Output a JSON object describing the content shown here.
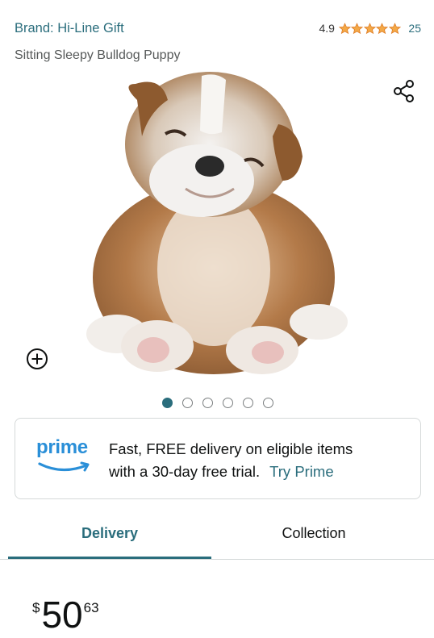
{
  "product": {
    "brand_label": "Brand: Hi-Line Gift",
    "rating_value": "4.9",
    "rating_stars": 4.9,
    "rating_count": "25",
    "title": "Sitting Sleepy Bulldog Puppy",
    "image_name": "bulldog-puppy-figurine",
    "image_count": 6,
    "active_image_index": 0
  },
  "icons": {
    "share": "share-icon",
    "zoom": "plus-circle-icon",
    "star": "star-icon"
  },
  "prime": {
    "logo_word": "prime",
    "line1": "Fast, FREE delivery on eligible items",
    "line2": "with a 30-day free trial.",
    "cta": "Try Prime",
    "logo_color": "#2a8fd8"
  },
  "tabs": [
    {
      "label": "Delivery",
      "active": true
    },
    {
      "label": "Collection",
      "active": false
    }
  ],
  "price": {
    "symbol": "$",
    "whole": "50",
    "fraction": "63"
  },
  "colors": {
    "accent": "#2a6d7c",
    "star": "#f3a847",
    "text_secondary": "#565959"
  }
}
